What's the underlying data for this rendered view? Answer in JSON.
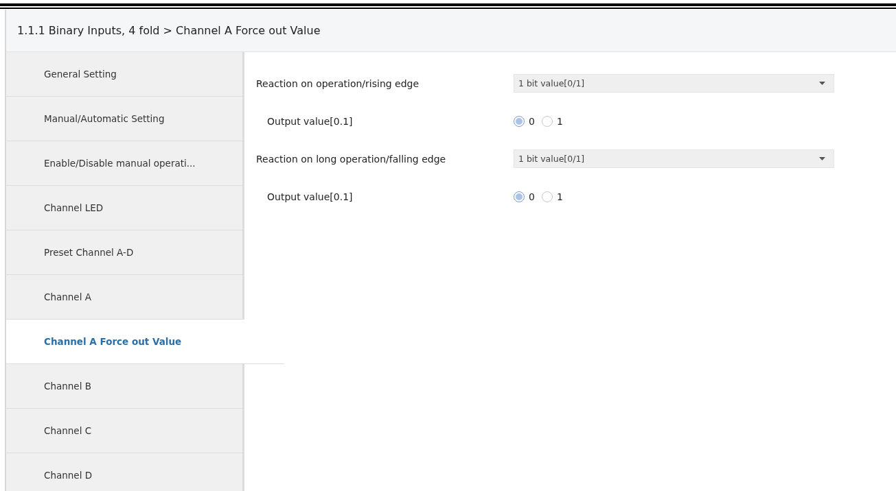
{
  "header": {
    "title": "1.1.1 Binary Inputs, 4 fold > Channel A Force out Value"
  },
  "sidebar": {
    "items": [
      {
        "label": "General Setting",
        "selected": false
      },
      {
        "label": "Manual/Automatic Setting",
        "selected": false
      },
      {
        "label": "Enable/Disable manual operati...",
        "selected": false
      },
      {
        "label": "Channel LED",
        "selected": false
      },
      {
        "label": "Preset Channel A-D",
        "selected": false
      },
      {
        "label": "Channel A",
        "selected": false
      },
      {
        "label": "Channel A Force out Value",
        "selected": true
      },
      {
        "label": "Channel B",
        "selected": false
      },
      {
        "label": "Channel C",
        "selected": false
      },
      {
        "label": "Channel D",
        "selected": false
      }
    ]
  },
  "parameters": [
    {
      "kind": "dropdown",
      "label": "Reaction on operation/rising edge",
      "value": "1 bit value[0/1]"
    },
    {
      "kind": "radio",
      "label": "Output value[0.1]",
      "options": [
        {
          "label": "0",
          "selected": true
        },
        {
          "label": "1",
          "selected": false
        }
      ]
    },
    {
      "kind": "dropdown",
      "label": "Reaction on long operation/falling edge",
      "value": "1 bit value[0/1]"
    },
    {
      "kind": "radio",
      "label": "Output value[0.1]",
      "options": [
        {
          "label": "0",
          "selected": true
        },
        {
          "label": "1",
          "selected": false
        }
      ]
    }
  ]
}
